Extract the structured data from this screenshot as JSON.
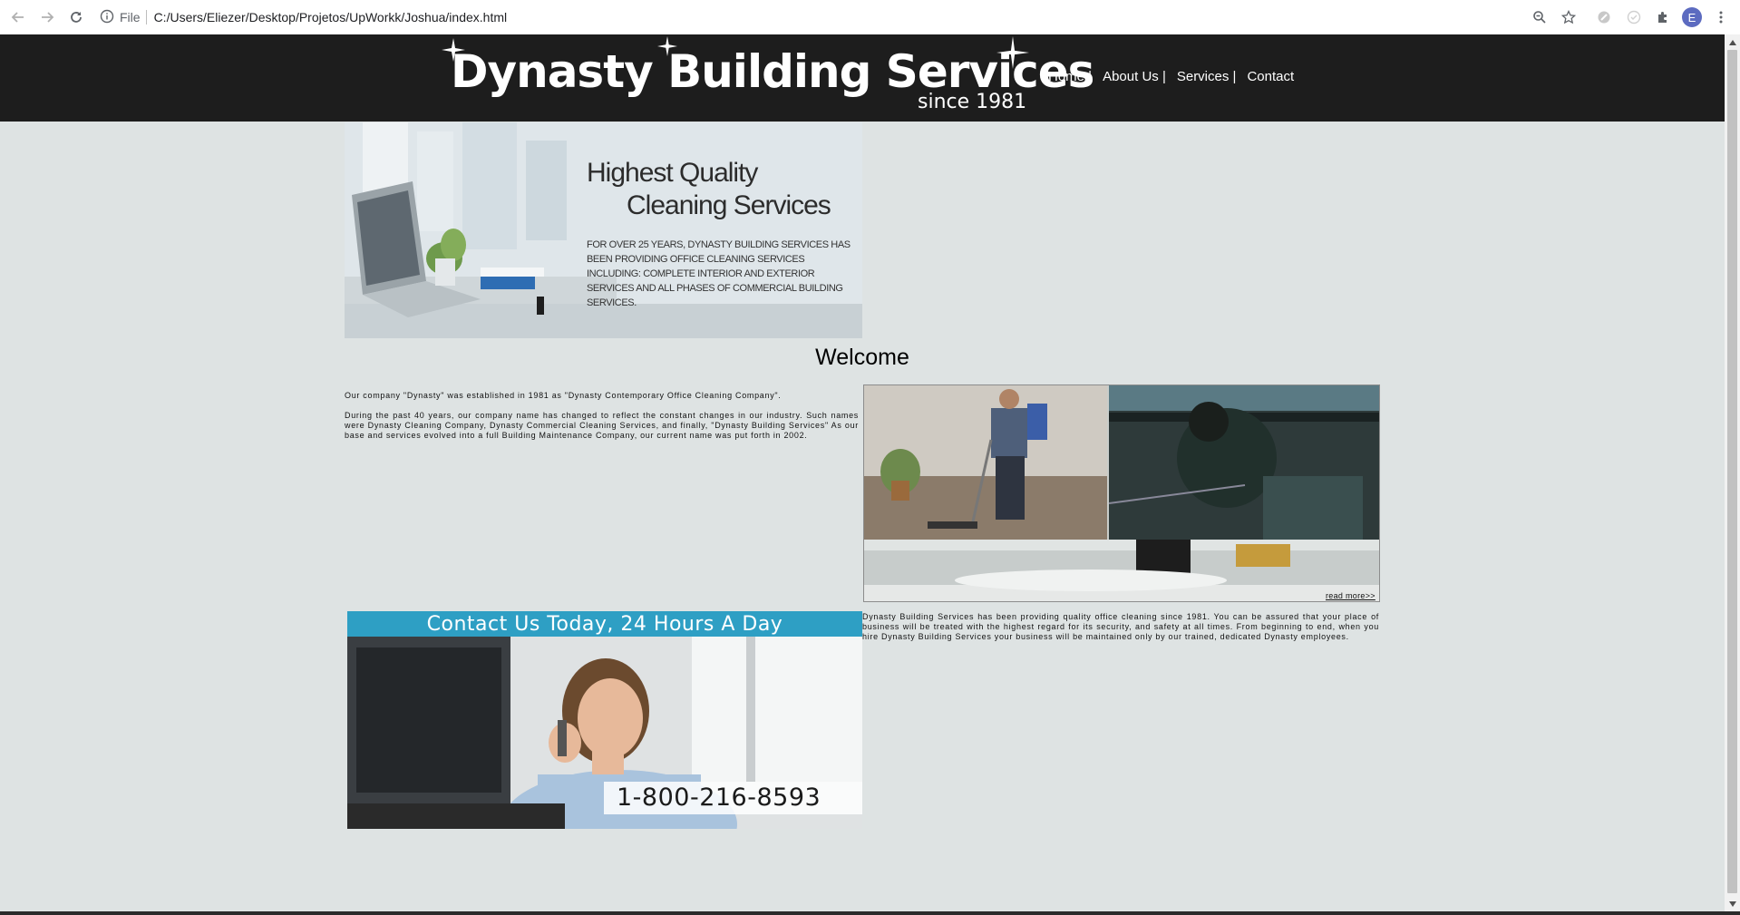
{
  "browser": {
    "file_label": "File",
    "url": "C:/Users/Eliezer/Desktop/Projetos/UpWorkk/Joshua/index.html",
    "avatar_initial": "E",
    "icons": [
      "back-arrow-icon",
      "forward-arrow-icon",
      "reload-icon",
      "info-icon",
      "zoom-icon",
      "star-icon",
      "extension-icon",
      "puzzle-icon",
      "more-icon"
    ]
  },
  "header": {
    "logo_title": "Dynasty Building Services",
    "logo_subtitle": "since 1981",
    "nav": [
      "Home |",
      "About Us |",
      "Services |",
      "Contact"
    ]
  },
  "hero": {
    "heading_line1": "Highest Quality",
    "heading_line2": "Cleaning Services",
    "text": "FOR OVER 25 YEARS, DYNASTY BUILDING SERVICES HAS BEEN PROVIDING OFFICE CLEANING SERVICES INCLUDING: COMPLETE INTERIOR AND EXTERIOR SERVICES AND ALL PHASES OF COMMERCIAL BUILDING SERVICES."
  },
  "welcome": {
    "title": "Welcome",
    "paragraph1": "Our company \"Dynasty\" was established in 1981 as \"Dynasty Contemporary Office Cleaning Company\".",
    "paragraph2": "During the past 40 years, our company name has changed to reflect the constant changes in our industry. Such names were Dynasty Cleaning Company, Dynasty Commercial Cleaning Services, and finally, \"Dynasty Building Services\" As our base and services evolved into a full Building Maintenance Company, our current name was put forth in 2002.",
    "read_more": "read more>>",
    "about": "Dynasty Building Services has been providing quality office cleaning since 1981. You can be assured that your place of business will be treated with the highest regard for its security, and safety at all times. From beginning to end, when you hire Dynasty Building Services your business will be maintained only by our trained, dedicated Dynasty employees."
  },
  "contact": {
    "banner_title": "Contact Us Today, 24 Hours A Day",
    "phone": "1-800-216-8593"
  },
  "colors": {
    "header_bg": "#1d1d1d",
    "page_bg": "#dee3e3",
    "contact_strip": "#2e9fc4"
  }
}
